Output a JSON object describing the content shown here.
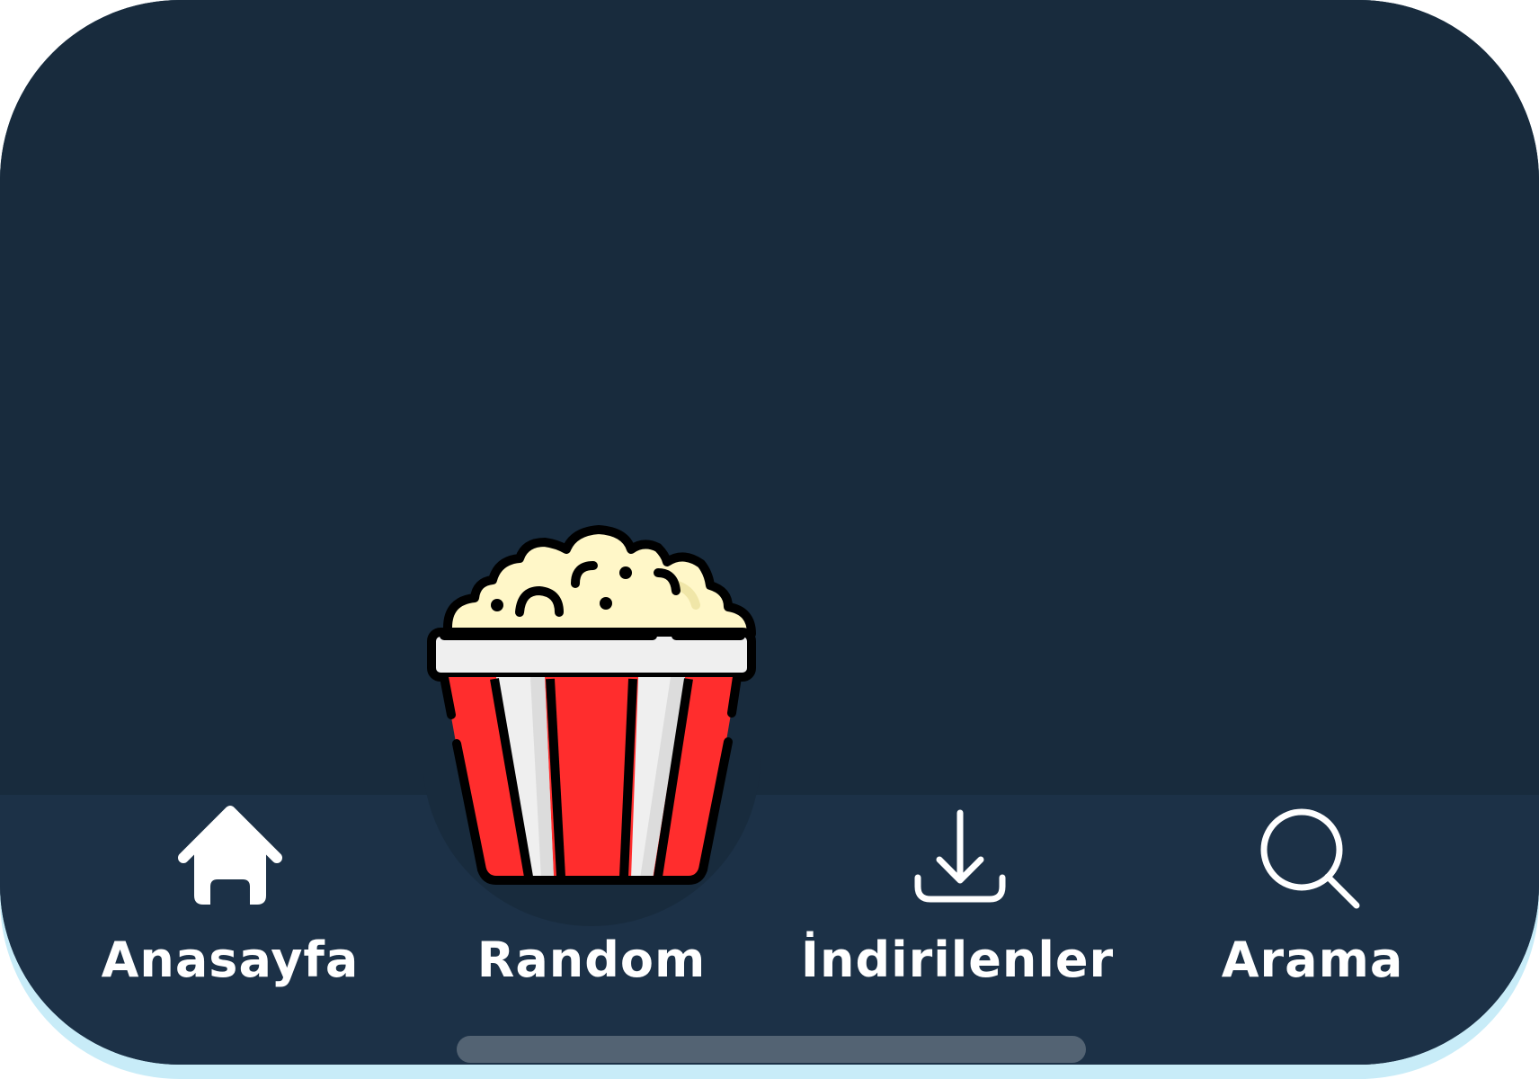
{
  "colors": {
    "background": "#182b3d",
    "tab_bar": "#1c3147",
    "label": "#ffffff",
    "popcorn_red": "#ff2d2d",
    "popcorn_white": "#efefef",
    "popcorn_kernel": "#fff7c8",
    "home_indicator": "#536373"
  },
  "tabs": [
    {
      "label": "Anasayfa",
      "icon": "home-icon"
    },
    {
      "label": "Random",
      "icon": "popcorn-icon"
    },
    {
      "label": "İndirilenler",
      "icon": "download-icon"
    },
    {
      "label": "Arama",
      "icon": "search-icon"
    }
  ]
}
